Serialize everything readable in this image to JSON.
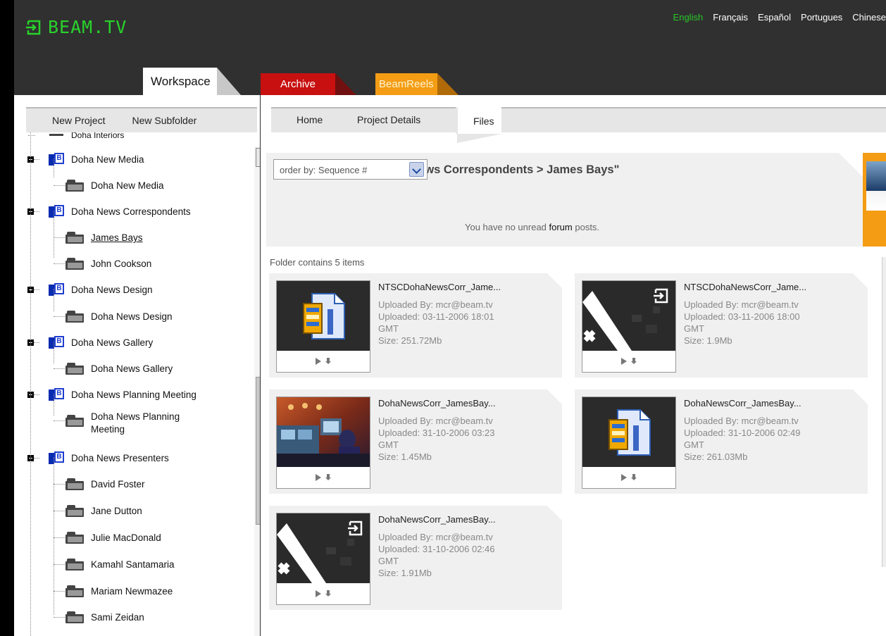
{
  "app": {
    "logo_text": "BEAM.TV",
    "languages": [
      "English",
      "Français",
      "Español",
      "Portugues",
      "Chinese"
    ],
    "active_language": "English",
    "colors": {
      "brand_green": "#29d22b",
      "archive_red": "#c81010",
      "reels_orange": "#f39c14",
      "header_bg": "#303030"
    }
  },
  "tabs": {
    "workspace": "Workspace",
    "archive": "Archive",
    "beamreels": "BeamReels"
  },
  "sidebar": {
    "new_project": "New Project",
    "new_subfolder": "New Subfolder",
    "top_cut_label": "Doha Interiors",
    "tree": [
      {
        "type": "project",
        "label": "Doha New Media"
      },
      {
        "type": "folder",
        "label": "Doha New Media"
      },
      {
        "type": "project",
        "label": "Doha News Correspondents"
      },
      {
        "type": "folder",
        "label": "James Bays",
        "selected": true
      },
      {
        "type": "folder",
        "label": "John Cookson"
      },
      {
        "type": "project",
        "label": "Doha News Design"
      },
      {
        "type": "folder",
        "label": "Doha News Design"
      },
      {
        "type": "project",
        "label": "Doha News Gallery"
      },
      {
        "type": "folder",
        "label": "Doha News Gallery"
      },
      {
        "type": "project",
        "label": "Doha News Planning Meeting"
      },
      {
        "type": "folder",
        "label_line1": "Doha News Planning",
        "label_line2": "Meeting"
      },
      {
        "type": "project",
        "label": "Doha News Presenters"
      },
      {
        "type": "folder",
        "label": "David Foster"
      },
      {
        "type": "folder",
        "label": "Jane Dutton"
      },
      {
        "type": "folder",
        "label": "Julie MacDonald"
      },
      {
        "type": "folder",
        "label": "Kamahl Santamaria"
      },
      {
        "type": "folder",
        "label": "Mariam Newmazee"
      },
      {
        "type": "folder",
        "label": "Sami Zeidan"
      }
    ]
  },
  "main": {
    "nav": {
      "home": "Home",
      "project_details": "Project Details",
      "files": "Files"
    },
    "folder_title": "Folder Contents: \"Doha News Correspondents > James Bays\"",
    "order_by": "order by: Sequence #",
    "forum_prefix": "You have no unread ",
    "forum_link": "forum",
    "forum_suffix": " posts.",
    "item_count": "Folder contains 5 items",
    "files": [
      {
        "name": "NTSCDohaNewsCorr_Jame...",
        "uploaded_by": "Uploaded By: mcr@beam.tv",
        "uploaded": "Uploaded: 03-11-2006 18:01",
        "tz": "GMT",
        "size": "Size: 251.72Mb",
        "thumb": "zip"
      },
      {
        "name": "NTSCDohaNewsCorr_Jame...",
        "uploaded_by": "Uploaded By: mcr@beam.tv",
        "uploaded": "Uploaded: 03-11-2006 18:00",
        "tz": "GMT",
        "size": "Size: 1.9Mb",
        "thumb": "beam"
      },
      {
        "name": "DohaNewsCorr_JamesBay...",
        "uploaded_by": "Uploaded By: mcr@beam.tv",
        "uploaded": "Uploaded: 31-10-2006 03:23",
        "tz": "GMT",
        "size": "Size: 1.45Mb",
        "thumb": "studio"
      },
      {
        "name": "DohaNewsCorr_JamesBay...",
        "uploaded_by": "Uploaded By: mcr@beam.tv",
        "uploaded": "Uploaded: 31-10-2006 02:49",
        "tz": "GMT",
        "size": "Size: 261.03Mb",
        "thumb": "zip"
      },
      {
        "name": "DohaNewsCorr_JamesBay...",
        "uploaded_by": "Uploaded By: mcr@beam.tv",
        "uploaded": "Uploaded: 31-10-2006 02:46",
        "tz": "GMT",
        "size": "Size: 1.91Mb",
        "thumb": "beam"
      }
    ]
  }
}
